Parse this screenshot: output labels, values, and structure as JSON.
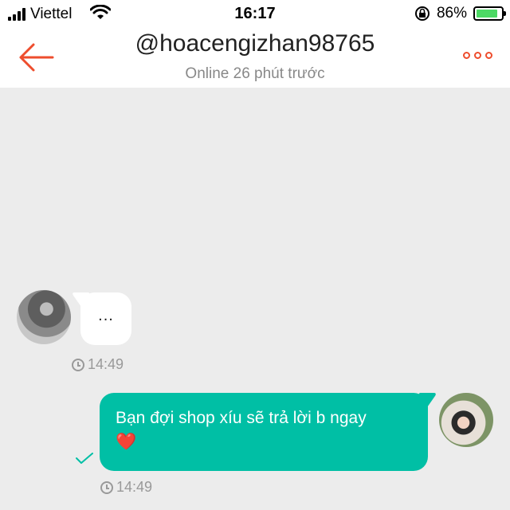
{
  "status_bar": {
    "carrier": "Viettel",
    "time": "16:17",
    "battery_percent": "86%",
    "battery_level": 0.86
  },
  "header": {
    "title": "@hoacengizhan98765",
    "subtitle": "Online 26 phút trước"
  },
  "messages": [
    {
      "sender": "other",
      "text": "...",
      "time": "14:49"
    },
    {
      "sender": "me",
      "text": "Bạn đợi shop xíu sẽ trả lời b ngay",
      "emoji": "❤️",
      "time": "14:49",
      "status": "sent"
    }
  ],
  "colors": {
    "accent": "#ee4d2d",
    "bubble_me": "#00bfa5",
    "background": "#ececec"
  },
  "icons": {
    "back": "arrow-left-icon",
    "more": "more-dots-icon",
    "clock": "clock-icon",
    "check": "check-icon"
  }
}
